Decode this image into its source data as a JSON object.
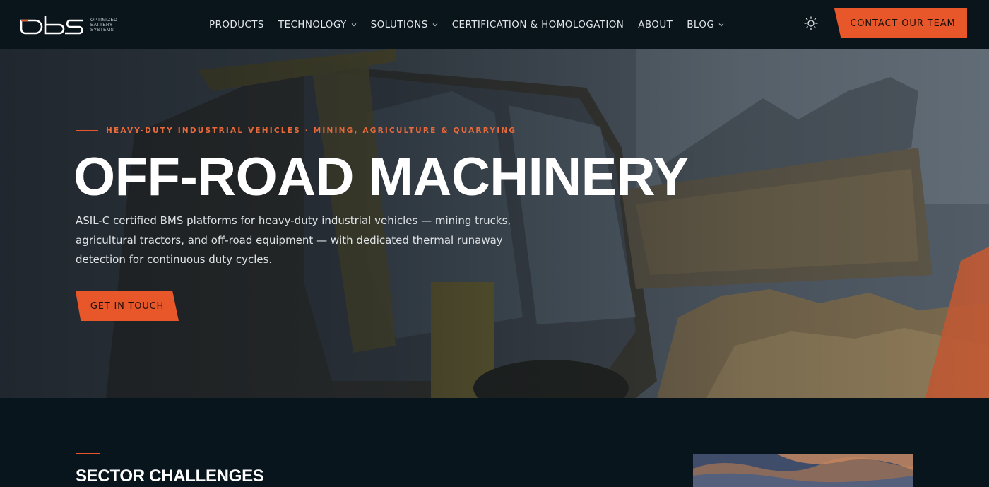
{
  "brand": {
    "logo_text": "obs",
    "tagline": [
      "OPTIMIZED",
      "BATTERY",
      "SYSTEMS"
    ],
    "accent_color": "#e8572a"
  },
  "nav": {
    "items": [
      {
        "label": "PRODUCTS",
        "has_dropdown": false
      },
      {
        "label": "TECHNOLOGY",
        "has_dropdown": true
      },
      {
        "label": "SOLUTIONS",
        "has_dropdown": true
      },
      {
        "label": "CERTIFICATION & HOMOLOGATION",
        "has_dropdown": false
      },
      {
        "label": "ABOUT",
        "has_dropdown": false
      },
      {
        "label": "BLOG",
        "has_dropdown": true
      }
    ],
    "theme_toggle_icon": "sun-icon",
    "contact_label": "CONTACT OUR TEAM"
  },
  "hero": {
    "eyebrow": "HEAVY-DUTY INDUSTRIAL VEHICLES · MINING, AGRICULTURE & QUARRYING",
    "title": "OFF-ROAD MACHINERY",
    "description": "ASIL-C certified BMS platforms for heavy-duty industrial vehicles — mining trucks, agricultural tractors, and off-road equipment — with dedicated thermal runaway detection for continuous duty cycles.",
    "cta_label": "GET IN TOUCH",
    "background_image": "backhoe-loader-photo"
  },
  "section": {
    "title": "SECTOR CHALLENGES",
    "image": "sky-sunset-photo"
  }
}
